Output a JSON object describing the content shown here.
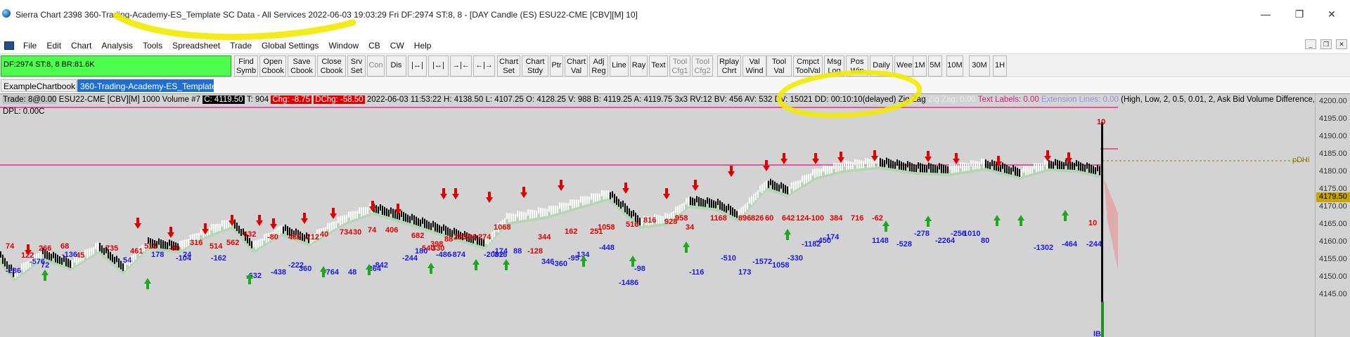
{
  "title": {
    "text": "Sierra Chart 2398 360-Trading-Academy-ES_Template  SC Data - All Services 2022-06-03  19:03:29 Fri  DF:2974  ST:8, 8 - [DAY Candle (ES) ESU22-CME [CBV][M]  10]"
  },
  "window_controls": {
    "minimize": "—",
    "restore": "❐",
    "close": "✕"
  },
  "menu": {
    "items": [
      "File",
      "Edit",
      "Chart",
      "Analysis",
      "Tools",
      "Spreadsheet",
      "Trade",
      "Global Settings",
      "Window",
      "CB",
      "CW",
      "Help"
    ]
  },
  "mdi_controls": [
    "_",
    "❐",
    "✕"
  ],
  "toolbar": {
    "df_text": "DF:2974  ST:8, 8  BR:81.6K",
    "buttons": [
      {
        "label1": "Find",
        "label2": "Symb",
        "grey": false
      },
      {
        "label1": "Open",
        "label2": "Cbook",
        "grey": false
      },
      {
        "label1": "Save",
        "label2": "Cbook",
        "grey": false
      },
      {
        "label1": "Close",
        "label2": "Cbook",
        "grey": false
      },
      {
        "label1": "Srv",
        "label2": "Set",
        "grey": false
      },
      {
        "label1": "Con",
        "label2": "",
        "grey": true
      },
      {
        "label1": "Dis",
        "label2": "",
        "grey": false
      },
      {
        "label1": "|↔|",
        "label2": "",
        "grey": false
      },
      {
        "label1": "|↔|",
        "label2": "",
        "grey": false
      },
      {
        "label1": "→|←",
        "label2": "",
        "grey": false
      },
      {
        "label1": "←|→",
        "label2": "",
        "grey": false
      },
      {
        "label1": "Chart",
        "label2": "Set",
        "grey": false
      },
      {
        "label1": "Chart",
        "label2": "Stdy",
        "grey": false
      },
      {
        "label1": "Ptr",
        "label2": "",
        "grey": false
      },
      {
        "label1": "Chart",
        "label2": "Val",
        "grey": false
      },
      {
        "label1": "Adj",
        "label2": "Reg",
        "grey": false
      },
      {
        "label1": "Line",
        "label2": "",
        "grey": false
      },
      {
        "label1": "Ray",
        "label2": "",
        "grey": false
      },
      {
        "label1": "Text",
        "label2": "",
        "grey": false
      },
      {
        "label1": "Tool",
        "label2": "Cfg1",
        "grey": true
      },
      {
        "label1": "Tool",
        "label2": "Cfg2",
        "grey": true
      },
      {
        "label1": "Rplay",
        "label2": "Chrt",
        "grey": false
      },
      {
        "label1": "Val",
        "label2": "Wind",
        "grey": false
      },
      {
        "label1": "Tool",
        "label2": "Val",
        "grey": false
      },
      {
        "label1": "Cmpct",
        "label2": "ToolVal",
        "grey": false
      },
      {
        "label1": "Msg",
        "label2": "Log",
        "grey": false
      },
      {
        "label1": "Pos",
        "label2": "Win",
        "grey": false
      },
      {
        "label1": "Daily",
        "label2": "",
        "grey": false
      },
      {
        "label1": "Week",
        "label2": "",
        "grey": false
      },
      {
        "label1": "1M",
        "label2": "",
        "grey": false
      },
      {
        "label1": "5M",
        "label2": "",
        "grey": false
      },
      {
        "label1": "10M",
        "label2": "",
        "grey": false
      },
      {
        "label1": "30M",
        "label2": "",
        "grey": false
      },
      {
        "label1": "1H",
        "label2": "",
        "grey": false
      }
    ]
  },
  "tabs": [
    {
      "label": "ExampleChartbook",
      "active": false
    },
    {
      "label": "360-Trading-Academy-ES_Template",
      "active": true
    }
  ],
  "chart": {
    "info": {
      "trade": "Trade: 8@0.00",
      "symbol": "ESU22-CME [CBV][M]  1000 Volume  #7",
      "close": "C: 4119.50",
      "trades": "T: 904",
      "chg": "Chg: -8.75",
      "dchg": "DChg: -58.50",
      "rest": "2022-06-03 11:53:22 H: 4138.50 L: 4107.25 O: 4128.25 V: 988 B: 4119.25 A: 4119.75 3x3 RV:12 BV: 456 AV: 532 DV: 15021 DD: 00:10:10(delayed) Zig Zag",
      "zigzag_faded": "Zig Zag: 0.00",
      "text_labels": "Text Labels: 0.00",
      "extension_lines": "Extension Lines: 0.00",
      "params": "(High, Low, 2, 0.5, 0.01, 2, Ask Bid Volume Difference, No,"
    },
    "dpl": "DPL: 0.00C",
    "price_ticks": [
      "4200.00",
      "4195.00",
      "4190.00",
      "4185.00",
      "4180.00",
      "4175.00",
      "4170.00",
      "4165.00",
      "4160.00",
      "4155.00",
      "4150.00",
      "4145.00"
    ],
    "current_price": "4179.50",
    "pdhi_label": "pDHi",
    "bar_label": "10",
    "bottom_label": "IB",
    "red_labels": [
      "74",
      "122",
      "266",
      "68",
      "45",
      "735",
      "461",
      "512",
      "-80",
      "316",
      "514",
      "562",
      "632",
      "-80",
      "482",
      "-212",
      "40",
      "734",
      "30",
      "74",
      "406",
      "682",
      "330",
      "540",
      "398",
      "88",
      "280",
      "599",
      "274",
      "1068",
      "-128",
      "344",
      "162",
      "251",
      "1058",
      "516",
      "816",
      "928",
      "958",
      "34",
      "1168",
      "896",
      "826",
      "60",
      "642",
      "124",
      "-100",
      "384",
      "716",
      "-62",
      "10"
    ],
    "blue_labels": [
      "-286",
      "-576",
      "72",
      "-136",
      "54",
      "178",
      "-104",
      "24",
      "-162",
      "-632",
      "-438",
      "-222",
      "360",
      "-764",
      "48",
      "-264",
      "-842",
      "-244",
      "180",
      "-486",
      "-874",
      "-2002",
      "316",
      "-174",
      "88",
      "346",
      "-360",
      "-95",
      "134",
      "-448",
      "-1486",
      "-98",
      "-116",
      "-510",
      "173",
      "-1572",
      "1058",
      "-330",
      "-1182",
      "-450",
      "174",
      "1148",
      "-528",
      "-278",
      "-2264",
      "-256",
      "1010",
      "80",
      "-1302",
      "-464",
      "-244"
    ]
  },
  "colors": {
    "accent_tab": "#1f6fd0",
    "df_box": "#4cff4c",
    "annotation_yellow": "#f2ea00",
    "pdhi_line": "#e0157d",
    "chart_bg": "#d3d3d3"
  }
}
